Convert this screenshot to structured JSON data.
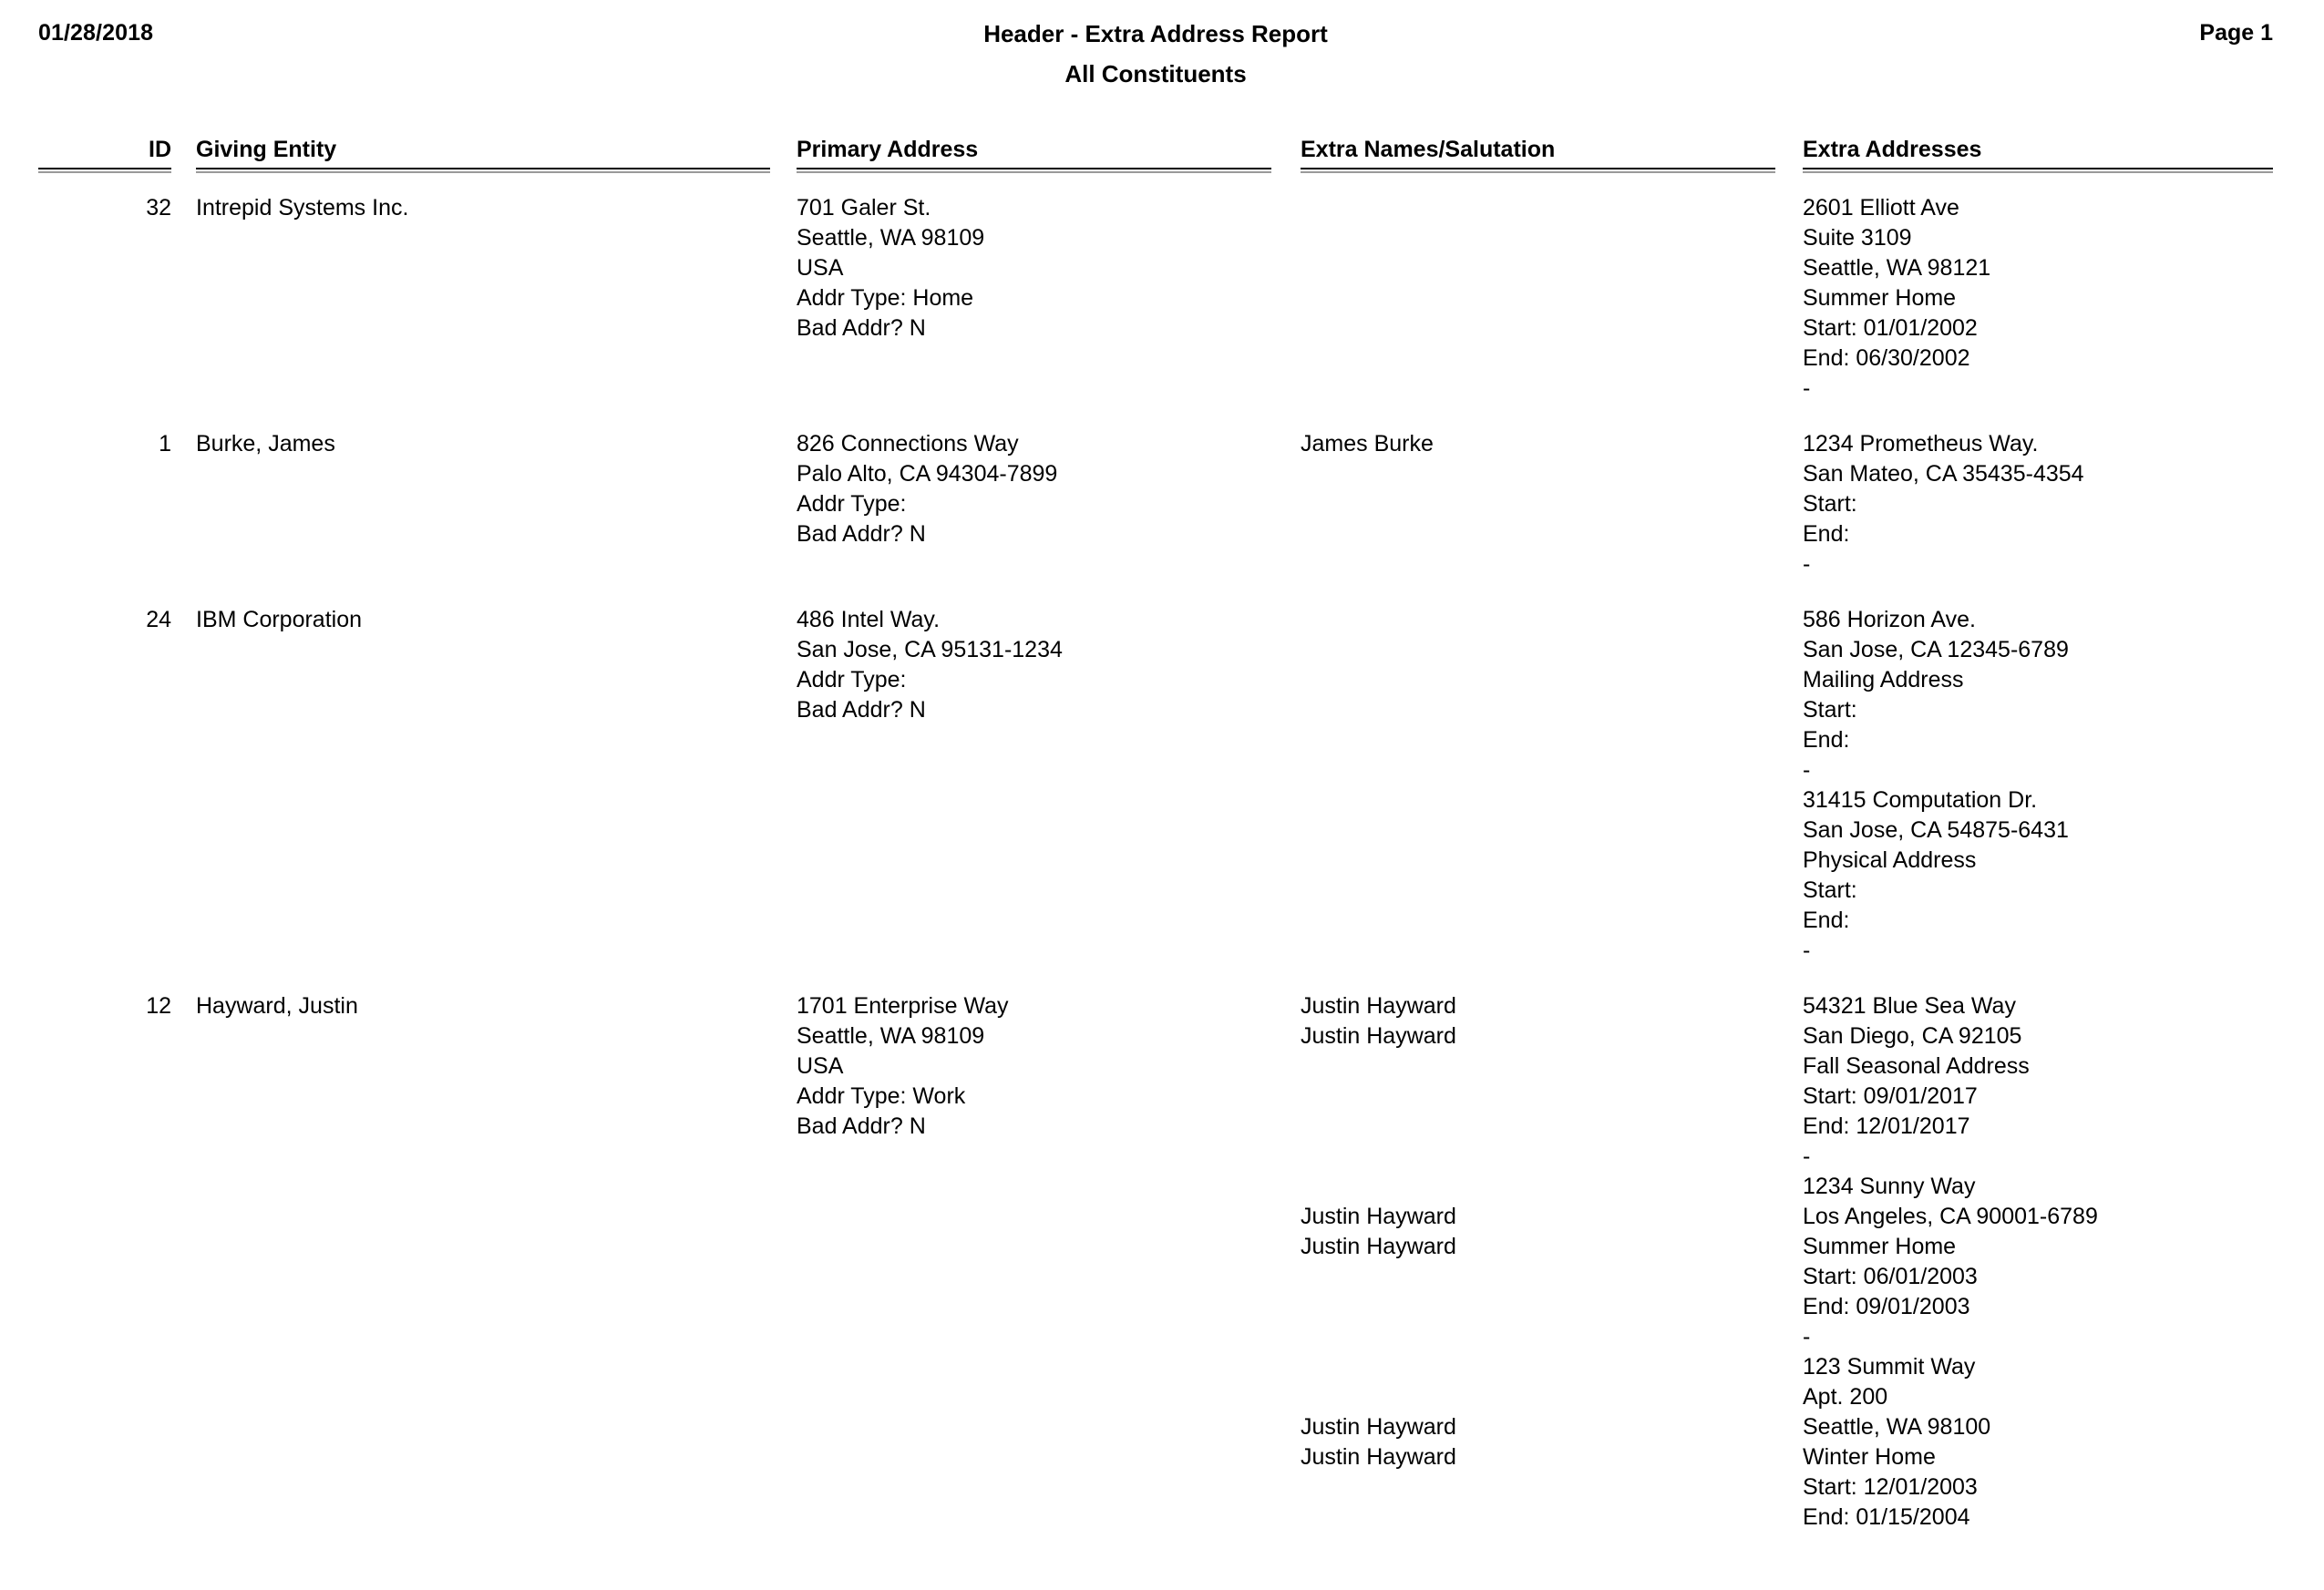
{
  "header": {
    "date": "01/28/2018",
    "title": "Header - Extra Address Report",
    "subtitle": "All Constituents",
    "page": "Page 1"
  },
  "columns": {
    "id": "ID",
    "entity": "Giving Entity",
    "primary": "Primary Address",
    "names": "Extra Names/Salutation",
    "extra": "Extra Addresses"
  },
  "rows": [
    {
      "id": "32",
      "entity": "Intrepid Systems Inc.",
      "primary_lines": [
        "701 Galer St.",
        "Seattle, WA 98109",
        "USA",
        "Addr Type: Home",
        "Bad Addr? N"
      ],
      "names_lines": [],
      "extra_lines": [
        "2601 Elliott Ave",
        "Suite 3109",
        "Seattle, WA 98121",
        "Summer Home",
        "Start: 01/01/2002",
        "End: 06/30/2002",
        "-"
      ]
    },
    {
      "id": "1",
      "entity": "Burke, James",
      "primary_lines": [
        "826 Connections Way",
        "Palo Alto, CA 94304-7899",
        "Addr Type:",
        "Bad Addr? N"
      ],
      "names_lines": [
        "James Burke"
      ],
      "extra_lines": [
        "1234 Prometheus Way.",
        "San Mateo, CA 35435-4354",
        "Start:",
        "End:",
        "-"
      ]
    },
    {
      "id": "24",
      "entity": "IBM Corporation",
      "primary_lines": [
        "486 Intel Way.",
        "San Jose, CA 95131-1234",
        "Addr Type:",
        "Bad Addr? N"
      ],
      "names_lines": [],
      "extra_lines": [
        "586 Horizon Ave.",
        "San Jose, CA 12345-6789",
        "Mailing Address",
        "Start:",
        "End:",
        "-",
        "31415 Computation Dr.",
        "San Jose, CA 54875-6431",
        "Physical Address",
        "Start:",
        "End:",
        "-"
      ]
    },
    {
      "id": "12",
      "entity": "Hayward, Justin",
      "primary_lines": [
        "1701 Enterprise Way",
        "Seattle, WA 98109",
        "USA",
        "Addr Type: Work",
        "Bad Addr? N"
      ],
      "names_lines": [
        "Justin Hayward",
        "Justin Hayward",
        "",
        "",
        "",
        "",
        "",
        "Justin Hayward",
        "Justin Hayward",
        "",
        "",
        "",
        "",
        "",
        "Justin Hayward",
        "Justin Hayward"
      ],
      "extra_lines": [
        "54321 Blue Sea Way",
        "San Diego, CA 92105",
        "Fall Seasonal Address",
        "Start: 09/01/2017",
        "End: 12/01/2017",
        "-",
        "1234 Sunny Way",
        "Los Angeles, CA 90001-6789",
        "Summer Home",
        "Start: 06/01/2003",
        "End: 09/01/2003",
        "-",
        "123 Summit Way",
        "Apt. 200",
        "Seattle, WA 98100",
        "Winter Home",
        "Start: 12/01/2003",
        "End: 01/15/2004"
      ]
    }
  ]
}
